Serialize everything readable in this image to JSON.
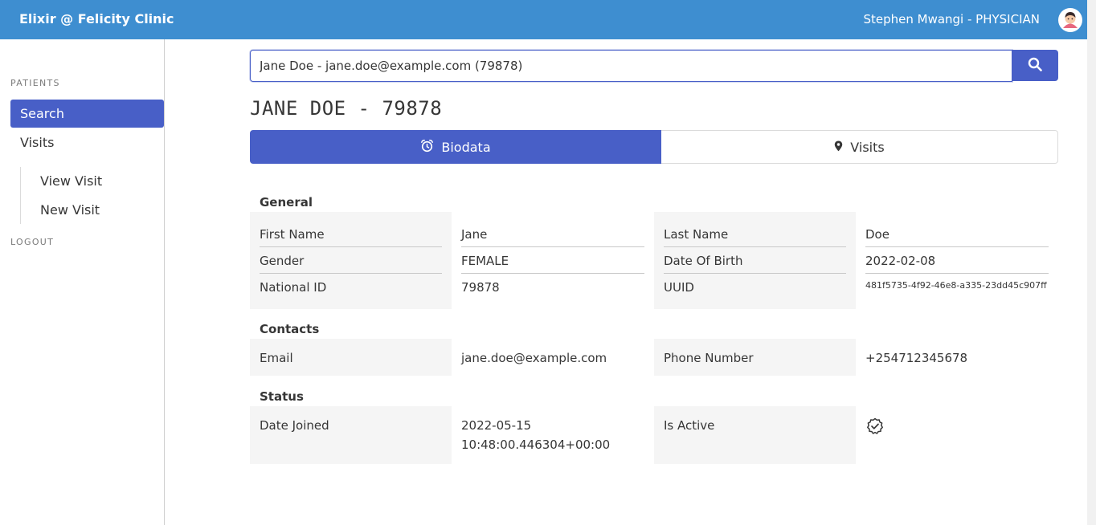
{
  "header": {
    "brand": "Elixir @ Felicity Clinic",
    "user": "Stephen Mwangi - PHYSICIAN",
    "avatar_icon": "user-avatar-icon"
  },
  "sidebar": {
    "section_patients": "PATIENTS",
    "items": [
      {
        "label": "Search",
        "active": true
      },
      {
        "label": "Visits",
        "active": false
      }
    ],
    "sub_items": [
      {
        "label": "View Visit"
      },
      {
        "label": "New Visit"
      }
    ],
    "logout": "LOGOUT"
  },
  "search": {
    "value": "Jane Doe - jane.doe@example.com (79878)",
    "button_icon": "search-icon"
  },
  "patient": {
    "title": "JANE DOE - 79878"
  },
  "tabs": [
    {
      "label": "Biodata",
      "icon": "alarm-clock-icon",
      "active": true
    },
    {
      "label": "Visits",
      "icon": "map-pin-icon",
      "active": false
    }
  ],
  "general": {
    "title": "General",
    "first_name_label": "First Name",
    "first_name": "Jane",
    "last_name_label": "Last Name",
    "last_name": "Doe",
    "gender_label": "Gender",
    "gender": "FEMALE",
    "dob_label": "Date Of Birth",
    "dob": "2022-02-08",
    "national_id_label": "National ID",
    "national_id": "79878",
    "uuid_label": "UUID",
    "uuid": "481f5735-4f92-46e8-a335-23dd45c907ff"
  },
  "contacts": {
    "title": "Contacts",
    "email_label": "Email",
    "email": "jane.doe@example.com",
    "phone_label": "Phone Number",
    "phone": "+254712345678"
  },
  "status": {
    "title": "Status",
    "date_joined_label": "Date Joined",
    "date_joined_line1": "2022-05-15",
    "date_joined_line2": "10:48:00.446304+00:00",
    "is_active_label": "Is Active",
    "is_active_icon": "verified-badge-icon"
  },
  "colors": {
    "navbar": "#3e8ed0",
    "primary": "#485fc7",
    "label_bg": "#f5f5f5"
  }
}
